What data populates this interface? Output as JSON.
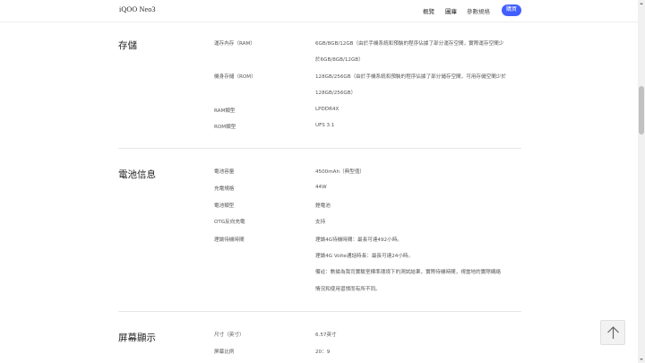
{
  "header": {
    "brand": "iQOO Neo3",
    "nav": [
      "概覽",
      "圖庫",
      "參數規格"
    ],
    "buy_label": "購買"
  },
  "sections": [
    {
      "title": "存儲",
      "rows": [
        {
          "label": "運存內存（RAM）",
          "values": [
            "6GB/8GB/12GB（由於手機系統和預裝的程序佔據了部分運存空間，實際運存空間少",
            "於6GB/8GB/12GB）"
          ]
        },
        {
          "label": "機身存儲（ROM）",
          "values": [
            "128GB/256GB（由於手機系統和預裝的程序佔據了部分儲存空間，可用存儲空間少於",
            "128GB/256GB）"
          ]
        },
        {
          "label": "RAM類型",
          "values": [
            "LPDDR4X"
          ]
        },
        {
          "label": "ROM類型",
          "values": [
            "UFS 3.1"
          ]
        }
      ]
    },
    {
      "title": "電池信息",
      "rows": [
        {
          "label": "電池容量",
          "values": [
            "4500mAh（典型值）"
          ]
        },
        {
          "label": "充電規格",
          "values": [
            "44W"
          ]
        },
        {
          "label": "電池類型",
          "values": [
            "鋰電池"
          ]
        },
        {
          "label": "OTG反向充電",
          "values": [
            "支持"
          ]
        },
        {
          "label": "理論待機時間",
          "values": [
            "理論4G待機時間：最長可達492小時。",
            "理論4G Volte通話時長：最長可達24小時。",
            "備註：數據為我司實驗室標準環境下的測試結果，實際待機時間，視當地的實際網絡",
            "情況和使用習慣而有所不同。"
          ]
        }
      ]
    },
    {
      "title": "屏幕顯示",
      "rows": [
        {
          "label": "尺寸（英寸）",
          "values": [
            "6.57英寸"
          ]
        },
        {
          "label": "屏幕比例",
          "values": [
            "20：9"
          ]
        }
      ]
    }
  ]
}
